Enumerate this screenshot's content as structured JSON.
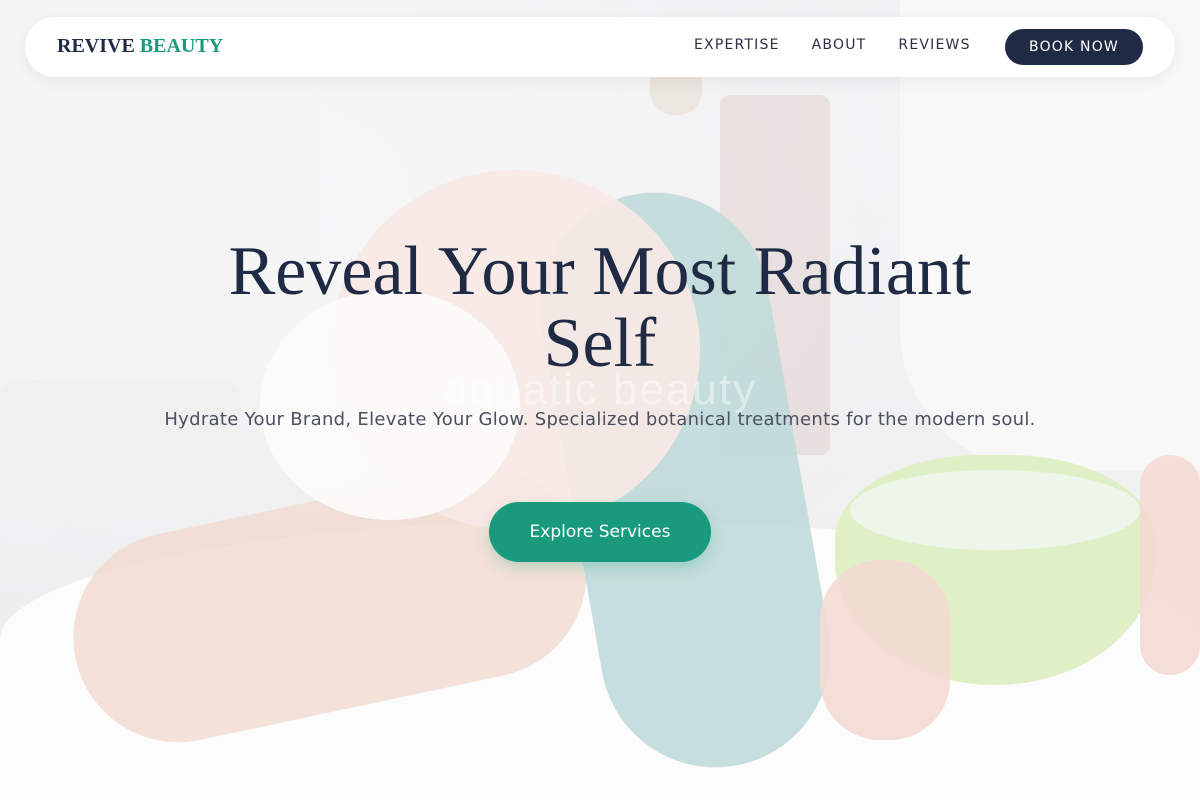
{
  "brand": {
    "name_primary": "REVIVE",
    "name_accent": "BEAUTY"
  },
  "nav": {
    "links": [
      {
        "label": "EXPERTISE"
      },
      {
        "label": "ABOUT"
      },
      {
        "label": "REVIEWS"
      }
    ],
    "cta_label": "BOOK NOW"
  },
  "hero": {
    "title": "Reveal Your Most Radiant Self",
    "subtitle": "Hydrate Your Brand, Elevate Your Glow. Specialized botanical treatments for the modern soul.",
    "button_label": "Explore Services",
    "background_watermark": "aquatic beauty"
  },
  "colors": {
    "navy": "#1f2a44",
    "accent_green": "#1a9a7d",
    "white": "#ffffff"
  }
}
